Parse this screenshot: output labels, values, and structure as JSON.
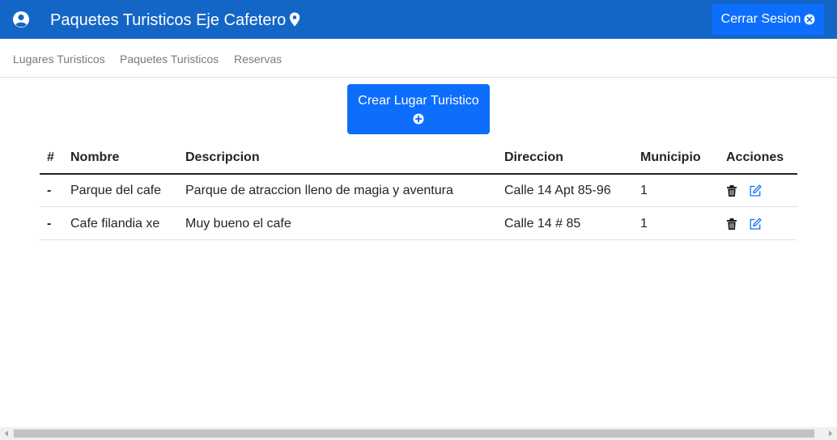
{
  "header": {
    "title": "Paquetes Turisticos Eje Cafetero",
    "logout_label": "Cerrar Sesion",
    "user_icon": "user-circle-icon",
    "title_icon": "map-pin-icon",
    "logout_icon": "circle-x-icon",
    "bg_color": "#1466c6",
    "button_color": "#0d6efd"
  },
  "nav": {
    "items": [
      {
        "label": "Lugares Turisticos"
      },
      {
        "label": "Paquetes Turisticos"
      },
      {
        "label": "Reservas"
      }
    ]
  },
  "main": {
    "create_label": "Crear Lugar Turistico",
    "create_icon": "plus-circle-icon"
  },
  "table": {
    "headers": [
      "#",
      "Nombre",
      "Descripcion",
      "Direccion",
      "Municipio",
      "Acciones"
    ],
    "rows": [
      {
        "id": "-",
        "nombre": "Parque del cafe",
        "descripcion": "Parque de atraccion lleno de magia y aventura",
        "direccion": "Calle 14 Apt 85-96",
        "municipio": "1"
      },
      {
        "id": "-",
        "nombre": "Cafe filandia xe",
        "descripcion": "Muy bueno el cafe",
        "direccion": "Calle 14 # 85",
        "municipio": "1"
      }
    ],
    "actions": [
      "trash-icon",
      "edit-icon"
    ]
  }
}
